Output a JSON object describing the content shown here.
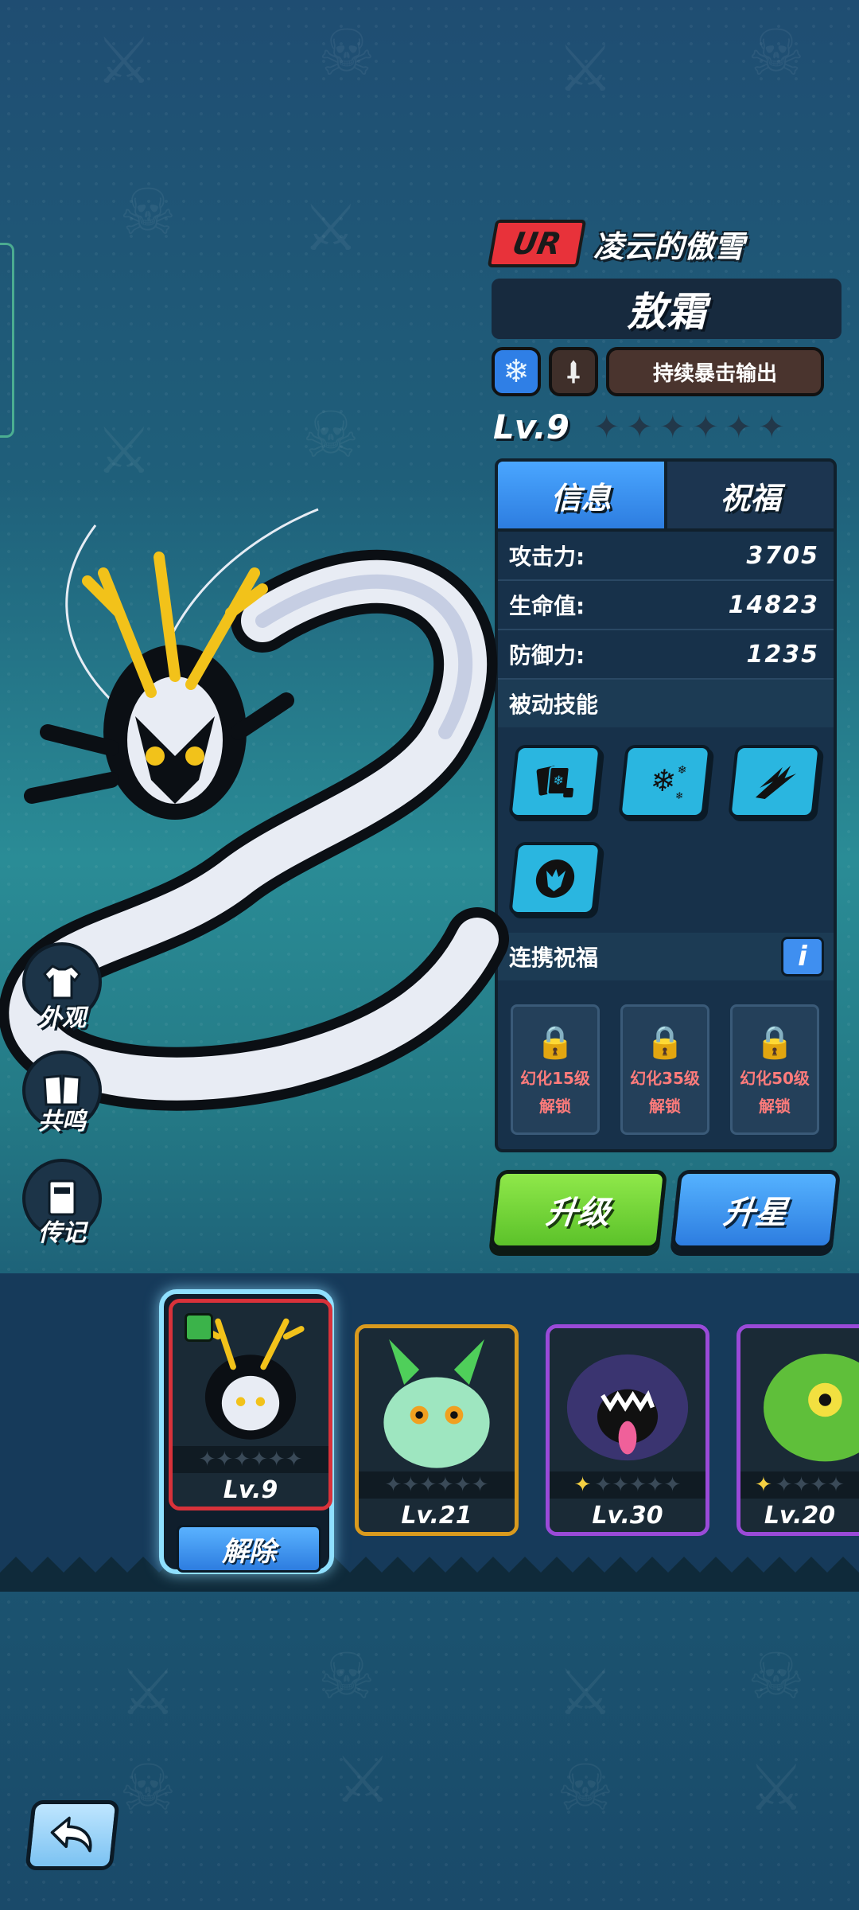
{
  "header": {
    "rarity": "UR",
    "title": "凌云的傲雪",
    "name": "敖霜",
    "trait": "持续暴击输出",
    "level": "Lv.9"
  },
  "tabs": [
    {
      "label": "信息",
      "active": true
    },
    {
      "label": "祝福",
      "active": false
    }
  ],
  "stats": [
    {
      "label": "攻击力:",
      "value": "3705"
    },
    {
      "label": "生命值:",
      "value": "14823"
    },
    {
      "label": "防御力:",
      "value": "1235"
    }
  ],
  "passive": {
    "title": "被动技能",
    "skills": [
      "cards-icon",
      "snowflake-icon",
      "claw-icon",
      "dragon-head-icon"
    ]
  },
  "blessing": {
    "title": "连携祝福",
    "info_label": "i",
    "locks": [
      {
        "line1": "幻化15级",
        "line2": "解锁"
      },
      {
        "line1": "幻化35级",
        "line2": "解锁"
      },
      {
        "line1": "幻化50级",
        "line2": "解锁"
      }
    ]
  },
  "actions": {
    "upgrade": "升级",
    "star_up": "升星"
  },
  "side": {
    "appearance": "外观",
    "resonance": "共鸣",
    "biography": "传记"
  },
  "roster": {
    "unequip": "解除",
    "pets": [
      {
        "level": "Lv.9",
        "frame": "#d8323a",
        "selected": true
      },
      {
        "level": "Lv.21",
        "frame": "#d99a1e",
        "selected": false
      },
      {
        "level": "Lv.30",
        "frame": "#9a4ad8",
        "selected": false
      },
      {
        "level": "Lv.20",
        "frame": "#9a4ad8",
        "selected": false
      }
    ]
  },
  "colors": {
    "ur_red": "#e8323a",
    "tab_active": "#2d7de0",
    "upgrade_green": "#5cc22a",
    "star_blue": "#2d7de0",
    "lock_text": "#ff7b7b"
  }
}
